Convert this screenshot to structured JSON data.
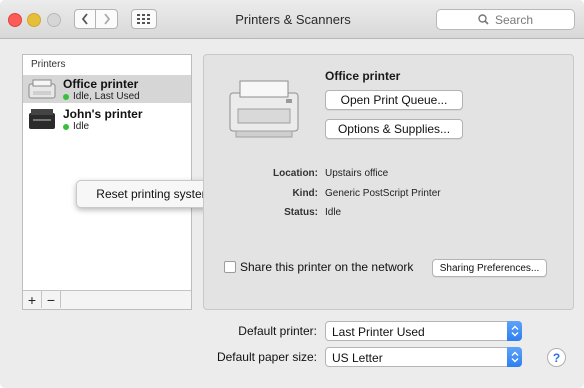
{
  "window": {
    "title": "Printers & Scanners",
    "search_placeholder": "Search"
  },
  "printers": {
    "header": "Printers",
    "items": [
      {
        "name": "Office printer",
        "status": "Idle, Last Used",
        "status_color": "#35c13a",
        "selected": true
      },
      {
        "name": "John's printer",
        "status": "Idle",
        "status_color": "#35c13a",
        "selected": false
      }
    ],
    "add_label": "+",
    "remove_label": "−"
  },
  "context_menu": {
    "item": "Reset printing system..."
  },
  "detail": {
    "name": "Office printer",
    "open_queue_label": "Open Print Queue...",
    "options_label": "Options & Supplies...",
    "location_label": "Location:",
    "location_value": "Upstairs office",
    "kind_label": "Kind:",
    "kind_value": "Generic PostScript Printer",
    "status_label": "Status:",
    "status_value": "Idle",
    "share_label": "Share this printer on the network",
    "share_checked": false,
    "sharing_prefs_label": "Sharing Preferences..."
  },
  "defaults": {
    "printer_label": "Default printer:",
    "printer_value": "Last Printer Used",
    "paper_label": "Default paper size:",
    "paper_value": "US Letter"
  },
  "help_label": "?",
  "colors": {
    "accent": "#2d7ff2",
    "status_green": "#35c13a"
  }
}
